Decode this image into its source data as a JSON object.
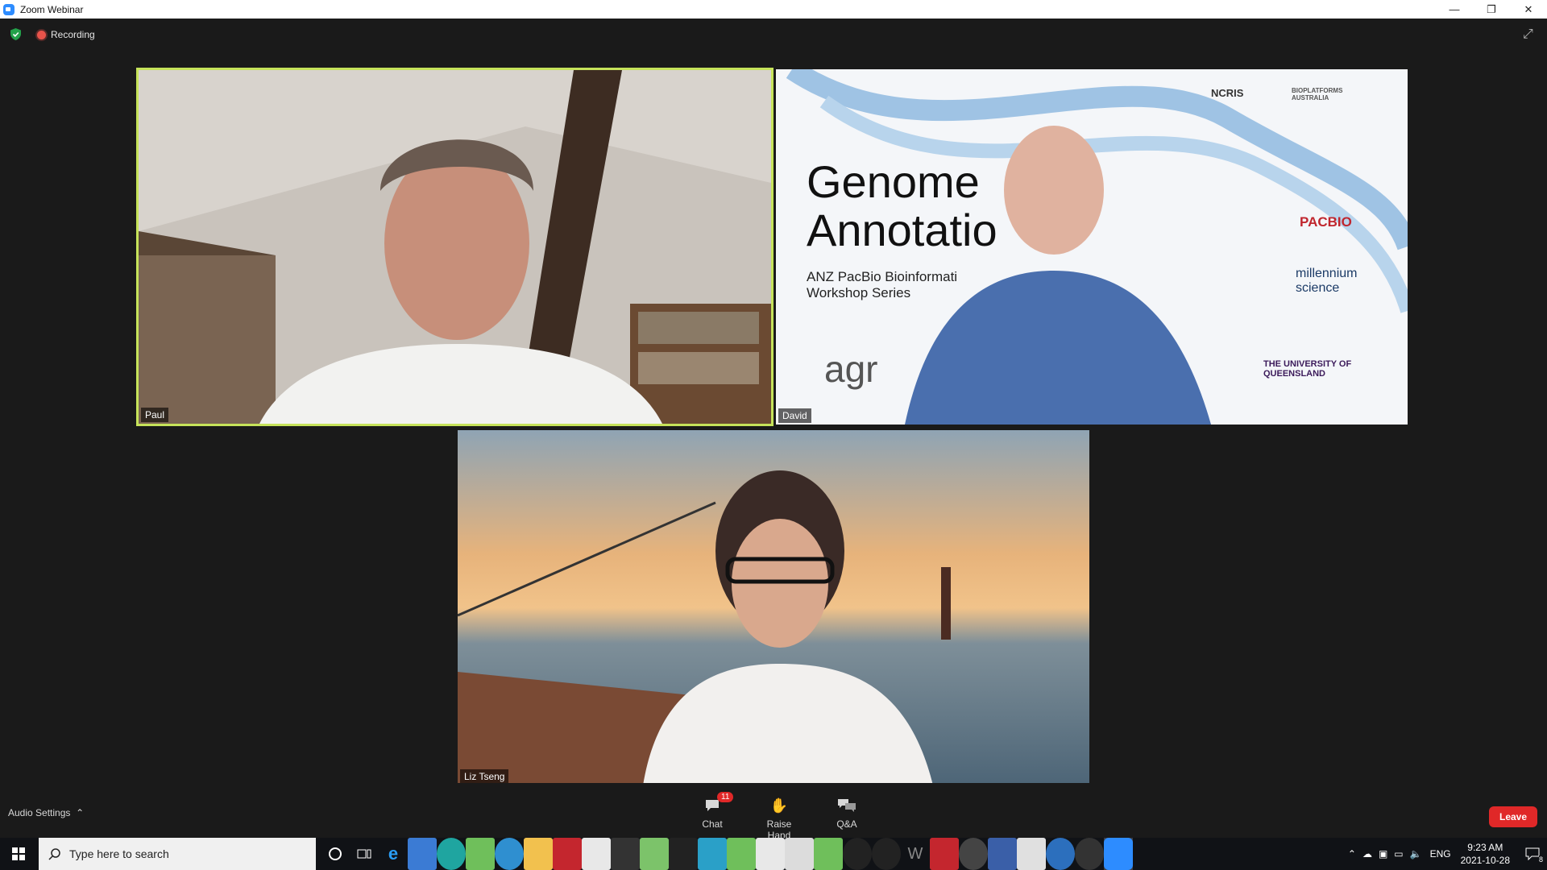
{
  "window": {
    "title": "Zoom Webinar",
    "controls": [
      "—",
      "❐",
      "✕"
    ]
  },
  "meeting": {
    "recording_label": "Recording",
    "participants": [
      {
        "name": "Paul"
      },
      {
        "name": "David"
      },
      {
        "name": "Liz Tseng"
      }
    ],
    "slide": {
      "title_line1": "Genome",
      "title_line2": "Annotatio",
      "subtitle_line1": "ANZ PacBio Bioinformati",
      "subtitle_line2": "Workshop Series",
      "logos": [
        "NCRIS",
        "BIOPLATFORMS AUSTRALIA",
        "PACBIO",
        "millennium science",
        "THE UNIVERSITY OF QUEENSLAND",
        "agr"
      ]
    }
  },
  "toolbar": {
    "audio_settings_label": "Audio Settings",
    "chat_label": "Chat",
    "chat_badge": "11",
    "raise_hand_label": "Raise Hand",
    "qa_label": "Q&A",
    "leave_label": "Leave"
  },
  "taskbar": {
    "search_placeholder": "Type here to search",
    "language": "ENG",
    "time": "9:23 AM",
    "date": "2021-10-28",
    "notifications_count": "8"
  },
  "colors": {
    "active_speaker_border": "#c6e35a",
    "leave": "#e02828",
    "zoom_blue": "#2d8cff"
  }
}
